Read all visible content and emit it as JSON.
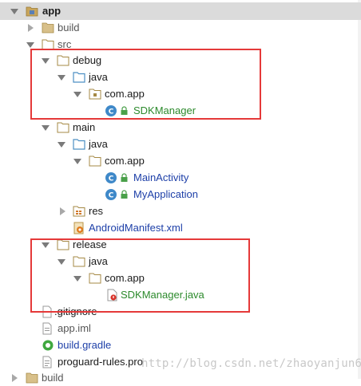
{
  "tree": {
    "app": "app",
    "build": "build",
    "src": "src",
    "debug": "debug",
    "debug_java": "java",
    "debug_pkg": "com.app",
    "debug_sdk": "SDKManager",
    "main": "main",
    "main_java": "java",
    "main_pkg": "com.app",
    "main_activity": "MainActivity",
    "my_application": "MyApplication",
    "res": "res",
    "manifest": "AndroidManifest.xml",
    "release": "release",
    "release_java": "java",
    "release_pkg": "com.app",
    "release_sdk": "SDKManager.java",
    "gitignore": ".gitignore",
    "app_iml": "app.iml",
    "build_gradle": "build.gradle",
    "proguard": "proguard-rules.pro",
    "build_bottom": "build"
  },
  "watermark": "http://blog.csdn.net/zhaoyanjun6",
  "colors": {
    "folder": "#c8a55b",
    "source_folder": "#4d90c4",
    "class_badge": "#3f89c9",
    "highlight_box": "#e53939",
    "link_blue": "#1d3fa8",
    "green_text": "#2c8a2c"
  }
}
